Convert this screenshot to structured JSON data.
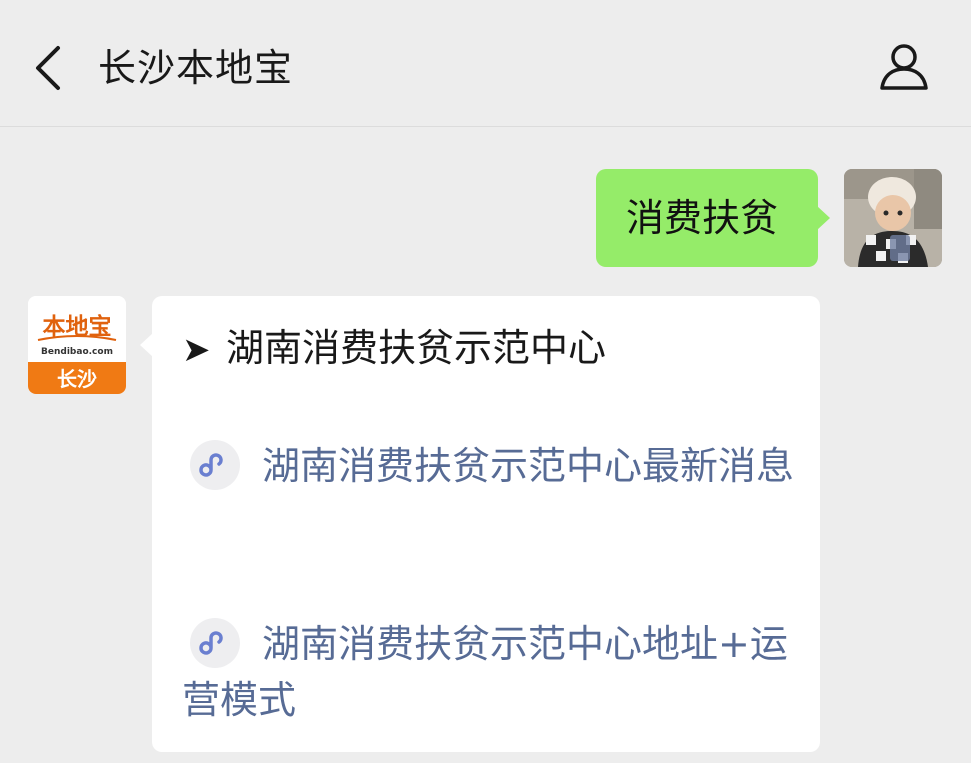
{
  "header": {
    "title": "长沙本地宝",
    "back_icon": "chevron-left-icon",
    "profile_icon": "person-icon"
  },
  "messages": {
    "outgoing": {
      "text": "消费扶贫",
      "bubble_color": "#95ec69"
    },
    "incoming": {
      "bot_avatar": {
        "top_text": "本地宝",
        "domain_text": "Bendibao.com",
        "city_text": "长沙",
        "accent_color": "#f07a14"
      },
      "heading_symbol": "➤",
      "heading": "湖南消费扶贫示范中心",
      "links": [
        {
          "icon": "mini-program-icon",
          "text": "湖南消费扶贫示范中心最新消息"
        },
        {
          "icon": "mini-program-icon",
          "text": "湖南消费扶贫示范中心地址+运营模式"
        }
      ],
      "link_color": "#576b95"
    }
  }
}
